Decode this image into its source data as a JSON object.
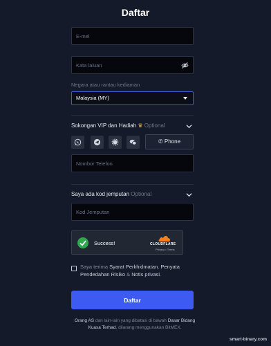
{
  "title": "Daftar",
  "email": {
    "placeholder": "E-mel",
    "value": ""
  },
  "password": {
    "placeholder": "Kata laluan",
    "value": "",
    "icon": "eye-off-icon"
  },
  "country": {
    "label": "Negara atau rantau kediaman",
    "selected": "Malaysia (MY)"
  },
  "vip": {
    "label": "Sokongan VIP dan Hadiah",
    "optional": "Optional",
    "crown_color": "#e8b33a"
  },
  "contact_methods": {
    "icons": [
      "whatsapp-icon",
      "telegram-icon",
      "signal-icon",
      "wechat-icon"
    ],
    "phone_button": "Phone"
  },
  "phone": {
    "placeholder": "Nombor Telefon",
    "value": ""
  },
  "referral": {
    "label": "Saya ada kod jemputan",
    "optional": "Optional",
    "placeholder": "Kod Jemputan",
    "value": ""
  },
  "captcha": {
    "status": "Success!",
    "brand": "CLOUDFLARE",
    "privacy": "Privacy",
    "separator": "•",
    "terms": "Terms",
    "check_color": "#2fa84f",
    "cloud_color": "#f38020"
  },
  "agreement": {
    "prefix": "Saya terima",
    "link1": "Syarat Perkhidmatan",
    "comma": ",",
    "link2": "Penyata Pendedahan Risiko",
    "amp": "&",
    "link3": "Notis privasi",
    "suffix": "."
  },
  "submit_label": "Daftar",
  "submit_color": "#3d5bf0",
  "footer": {
    "part1": "Orang AS",
    "part2": "dan lain-lain yang dibatasi di bawah",
    "link": "Dasar Bidang Kuasa Terhad",
    "part3": ", dilarang menggunakan BitMEX."
  },
  "watermark": "smart-binary.com"
}
